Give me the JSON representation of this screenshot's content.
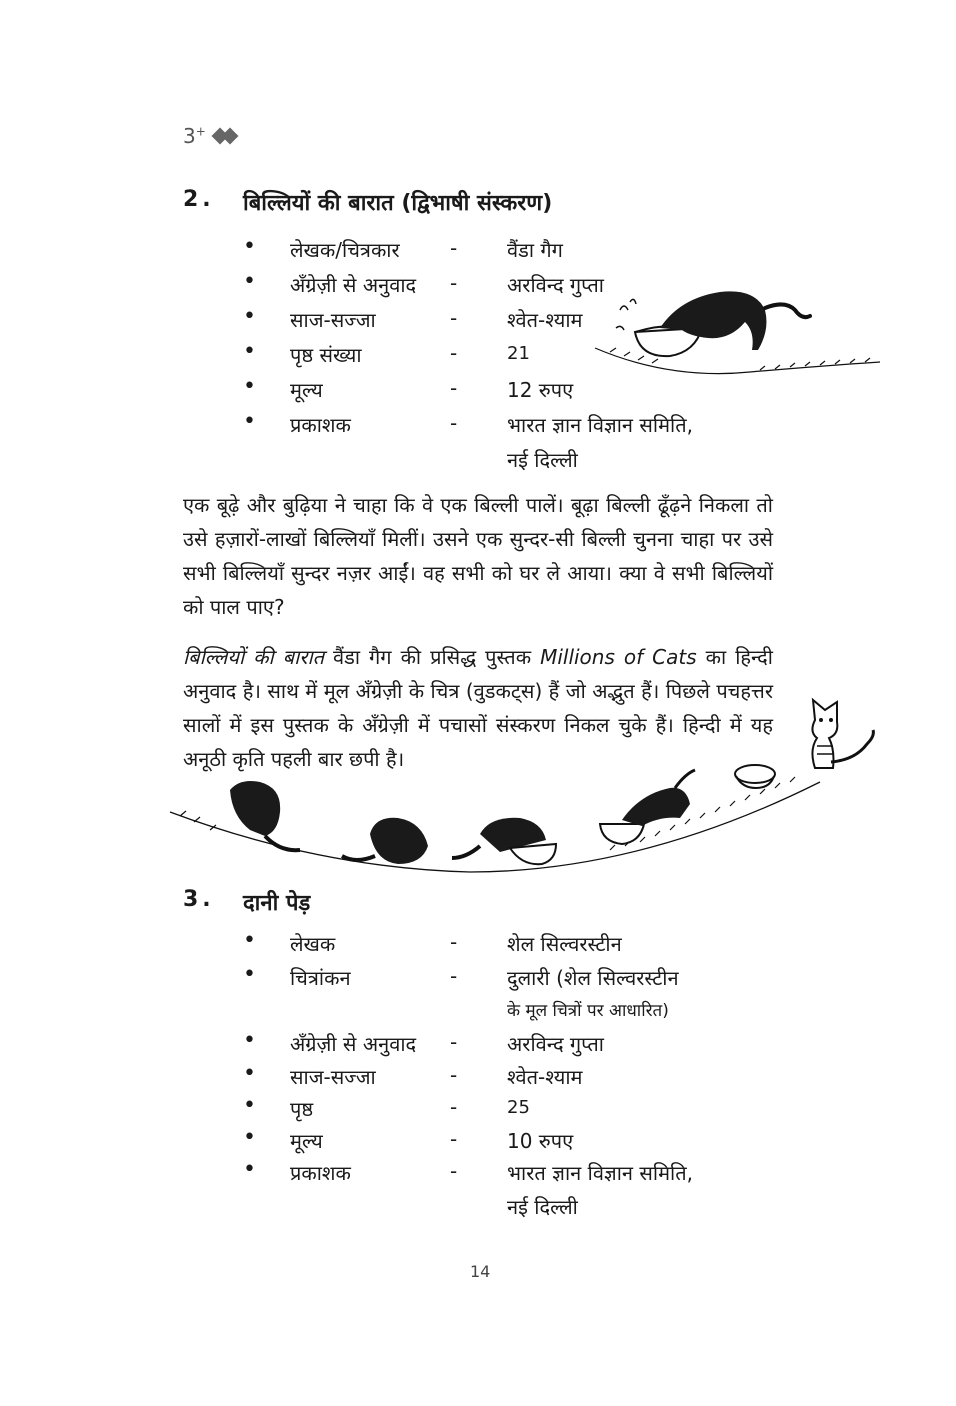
{
  "header": {
    "age_label": "3",
    "age_suffix": "+"
  },
  "section2": {
    "number": "2.",
    "title": "बिल्लियों की बारात (द्विभाषी संस्करण)",
    "rows": [
      {
        "bullet": "•",
        "label": "लेखक/चित्रकार",
        "dash": "-",
        "value": "वैंडा गैग"
      },
      {
        "bullet": "•",
        "label": "अँग्रेज़ी से अनुवाद",
        "dash": "-",
        "value": "अरविन्द गुप्ता"
      },
      {
        "bullet": "•",
        "label": "साज-सज्जा",
        "dash": "-",
        "value": "श्वेत-श्याम"
      },
      {
        "bullet": "•",
        "label": "पृष्ठ संख्या",
        "dash": "-",
        "value": "21"
      },
      {
        "bullet": "•",
        "label": "मूल्य",
        "dash": "-",
        "value": "12 रुपए"
      },
      {
        "bullet": "•",
        "label": "प्रकाशक",
        "dash": "-",
        "value": "भारत ज्ञान विज्ञान समिति,",
        "value2": "नई दिल्ली"
      }
    ],
    "para1": "एक बूढ़े और बुढ़िया ने चाहा कि वे एक बिल्ली पालें। बूढ़ा बिल्ली ढूँढ़ने निकला तो उसे हज़ारों-लाखों बिल्लियाँ मिलीं। उसने एक सुन्दर-सी बिल्ली चुनना चाहा पर उसे सभी बिल्लियाँ सुन्दर नज़र आईं। वह सभी को घर ले आया। क्या वे सभी बिल्लियों को पाल पाए?",
    "para2_italic": "बिल्लियों की बारात",
    "para2_a": " वैंडा गैग की प्रसिद्ध पुस्तक ",
    "para2_book": "Millions of Cats",
    "para2_b": " का हिन्दी अनुवाद है। साथ में मूल अँग्रेज़ी के चित्र (वुडकट्स) हैं जो अद्भुत हैं। पिछले पचहत्तर सालों में इस पुस्तक के अँग्रेज़ी में पचासों संस्करण निकल चुके हैं। हिन्दी में यह अनूठी कृति पहली बार छपी है।"
  },
  "section3": {
    "number": "3.",
    "title": "दानी पेड़",
    "rows": [
      {
        "bullet": "•",
        "label": "लेखक",
        "dash": "-",
        "value": "शेल सिल्वरस्टीन"
      },
      {
        "bullet": "•",
        "label": "चित्रांकन",
        "dash": "-",
        "value": "दुलारी (शेल सिल्वरस्टीन",
        "value2": "के मूल चित्रों पर आधारित)"
      },
      {
        "bullet": "•",
        "label": "अँग्रेज़ी से अनुवाद",
        "dash": "-",
        "value": "अरविन्द गुप्ता"
      },
      {
        "bullet": "•",
        "label": "साज-सज्जा",
        "dash": "-",
        "value": "श्वेत-श्याम"
      },
      {
        "bullet": "•",
        "label": "पृष्ठ",
        "dash": "-",
        "value": "25"
      },
      {
        "bullet": "•",
        "label": "मूल्य",
        "dash": "-",
        "value": "10 रुपए"
      },
      {
        "bullet": "•",
        "label": "प्रकाशक",
        "dash": "-",
        "value": "भारत ज्ञान विज्ञान समिति,",
        "value2": "नई दिल्ली"
      }
    ]
  },
  "footer": {
    "page_number": "14"
  },
  "illustrations": [
    "cat-drinking-from-bowl-icon",
    "cats-procession-icon",
    "sitting-kitten-icon"
  ]
}
